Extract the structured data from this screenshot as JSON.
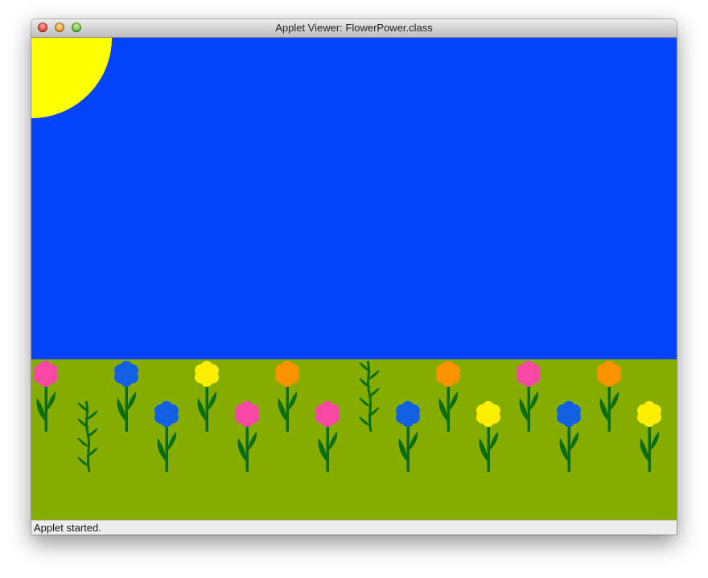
{
  "window": {
    "title": "Applet Viewer: FlowerPower.class",
    "controls": [
      "close-button",
      "minimize-button",
      "zoom-button"
    ]
  },
  "applet": {
    "colors": {
      "sky": "#0344fb",
      "grass": "#86ac00",
      "sun": "#ffff00",
      "stem": "#0c6e0d",
      "pink": "#f848a4",
      "blue": "#1261e4",
      "yellow": "#fbee00",
      "orange": "#fb9400"
    },
    "flowers": [
      {
        "type": "flower",
        "color": "pink"
      },
      {
        "type": "vine"
      },
      {
        "type": "flower",
        "color": "blue"
      },
      {
        "type": "flower",
        "color": "blue"
      },
      {
        "type": "flower",
        "color": "yellow"
      },
      {
        "type": "flower",
        "color": "pink"
      },
      {
        "type": "flower",
        "color": "orange"
      },
      {
        "type": "flower",
        "color": "pink"
      },
      {
        "type": "vine"
      },
      {
        "type": "flower",
        "color": "blue"
      },
      {
        "type": "flower",
        "color": "orange"
      },
      {
        "type": "flower",
        "color": "yellow"
      },
      {
        "type": "flower",
        "color": "pink"
      },
      {
        "type": "flower",
        "color": "blue"
      },
      {
        "type": "flower",
        "color": "orange"
      },
      {
        "type": "flower",
        "color": "yellow"
      }
    ]
  },
  "status": {
    "text": "Applet started."
  }
}
